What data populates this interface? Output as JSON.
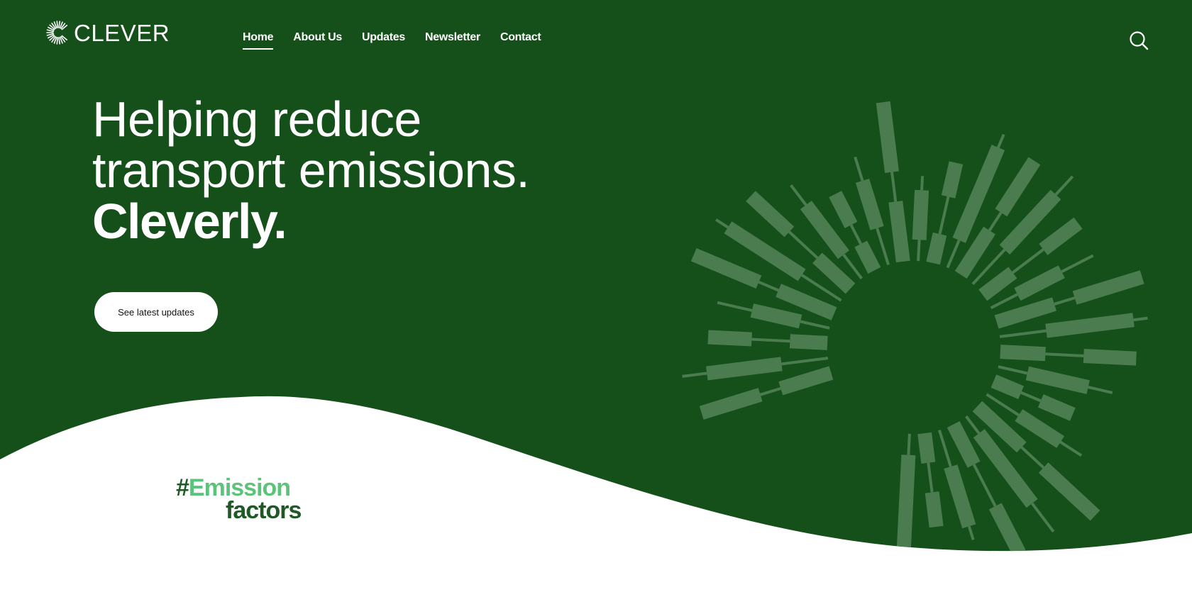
{
  "brand": {
    "name": "CLEVER"
  },
  "nav": {
    "items": [
      {
        "label": "Home"
      },
      {
        "label": "About Us"
      },
      {
        "label": "Updates"
      },
      {
        "label": "Newsletter"
      },
      {
        "label": "Contact"
      }
    ],
    "active_index": 0
  },
  "icons": {
    "logo": "sunburst-c-icon",
    "search": "search-icon"
  },
  "hero": {
    "headline_line1": "Helping reduce",
    "headline_line2": "transport emissions.",
    "headline_line3": "Cleverly.",
    "cta_label": "See latest updates"
  },
  "hashtag": {
    "hash": "#",
    "word": "Emission",
    "sub": "factors"
  },
  "colors": {
    "hero_green": "#154f1a",
    "sunburst": "#4b7c4f",
    "accent_light_green": "#5cc47a",
    "dark_green_text": "#1f5a26",
    "white": "#ffffff"
  }
}
